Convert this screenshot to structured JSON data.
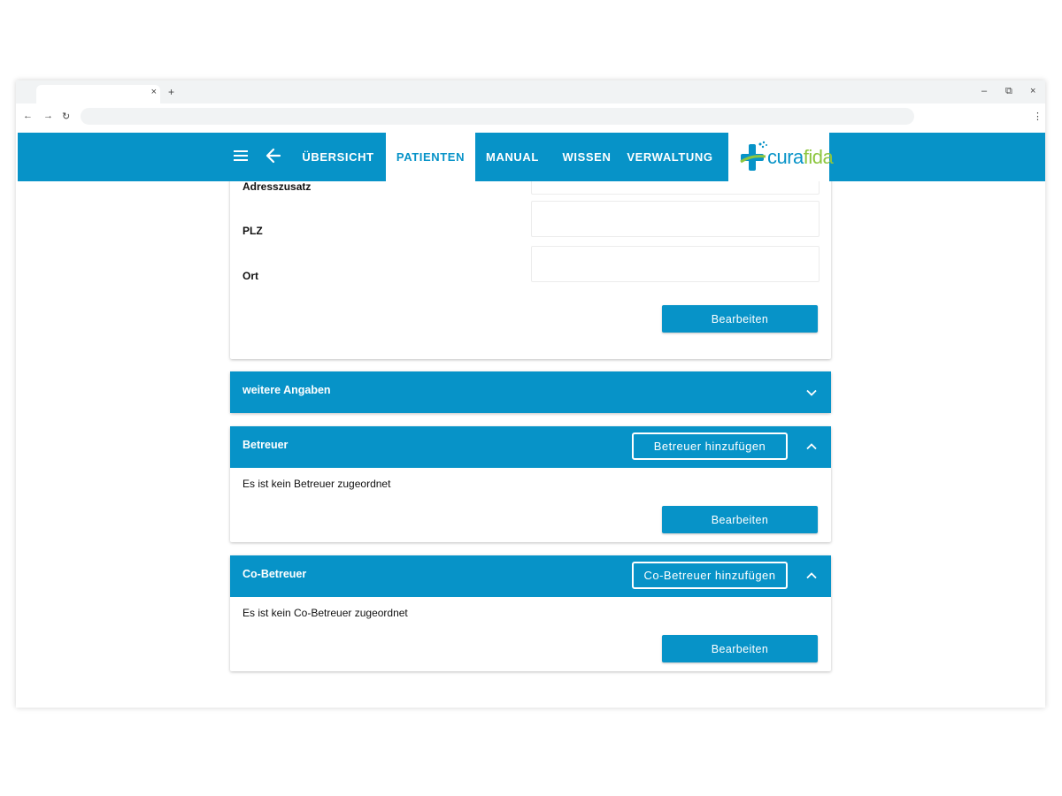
{
  "browser": {
    "tab_close": "×",
    "new_tab": "+",
    "minimize": "–",
    "restore": "⧉",
    "close": "×",
    "back": "←",
    "forward": "→",
    "reload": "↻",
    "menu": "⋮",
    "address_value": ""
  },
  "header": {
    "nav": [
      {
        "label": "ÜBERSICHT"
      },
      {
        "label": "PATIENTEN"
      },
      {
        "label": "MANUAL"
      },
      {
        "label": "WISSEN"
      },
      {
        "label": "VERWALTUNG"
      }
    ],
    "active_nav": "PATIENTEN",
    "logo": {
      "part1": "cura",
      "part2": "fida"
    },
    "icons": [
      "menu-icon",
      "arrow-left-icon"
    ]
  },
  "address_card": {
    "fields": [
      {
        "label": "Adresszusatz",
        "value": ""
      },
      {
        "label": "PLZ",
        "value": ""
      },
      {
        "label": "Ort",
        "value": ""
      }
    ],
    "edit_label": "Bearbeiten"
  },
  "weitere_angaben": {
    "title": "weitere Angaben",
    "expanded": false
  },
  "betreuer": {
    "title": "Betreuer",
    "add_label": "Betreuer hinzufügen",
    "empty_text": "Es ist kein Betreuer zugeordnet",
    "edit_label": "Bearbeiten",
    "expanded": true
  },
  "co_betreuer": {
    "title": "Co-Betreuer",
    "add_label": "Co-Betreuer hinzufügen",
    "empty_text": "Es ist kein Co-Betreuer zugeordnet",
    "edit_label": "Bearbeiten",
    "expanded": true
  },
  "colors": {
    "primary": "#0793c8",
    "logo_blue": "#0793c8",
    "logo_green": "#8dc63f"
  }
}
